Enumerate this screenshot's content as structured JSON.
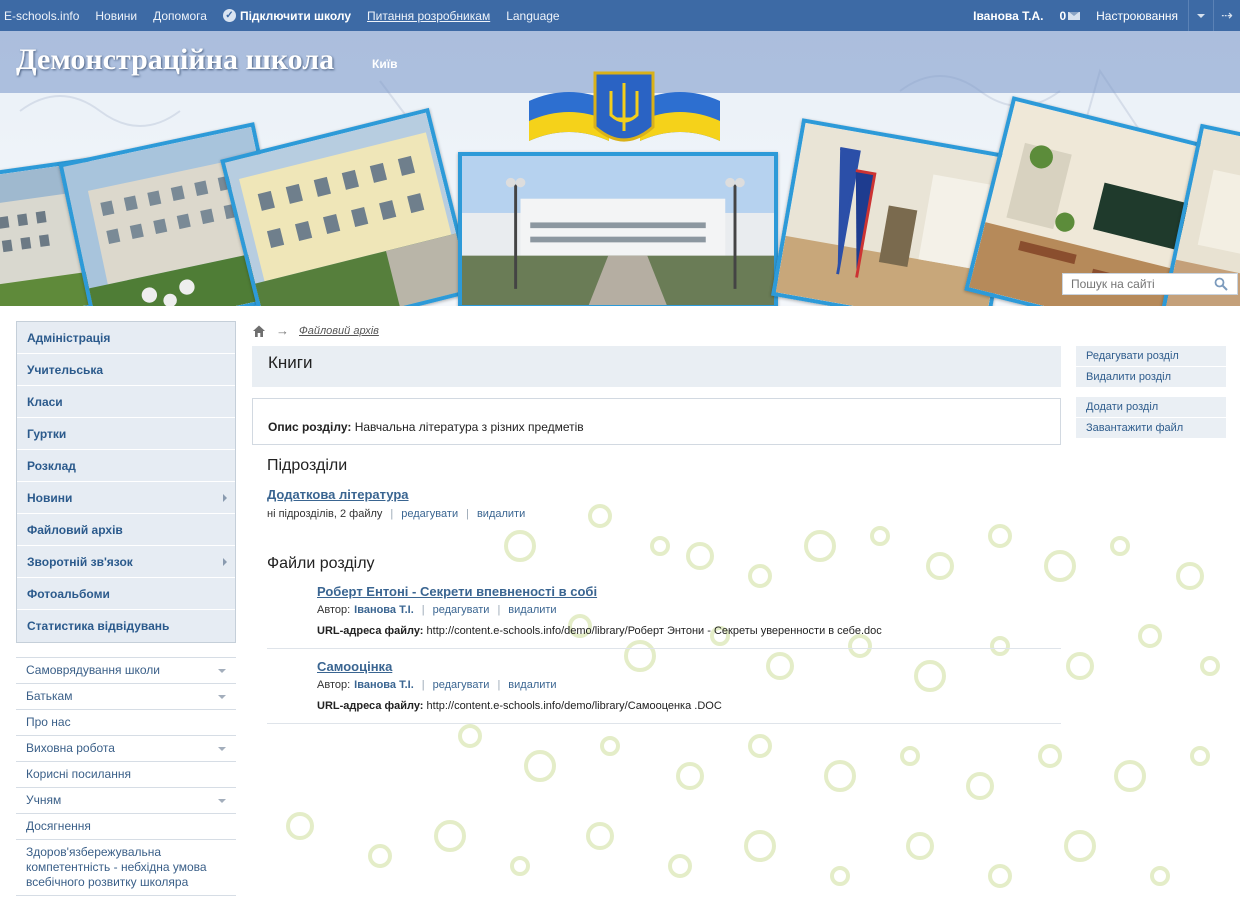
{
  "topbar": {
    "site": "E-schools.info",
    "news": "Новини",
    "help": "Допомога",
    "connect_school": "Підключити школу",
    "dev_questions": "Питання розробникам",
    "language": "Language",
    "user_name": "Іванова Т.А.",
    "messages_count": "0",
    "settings": "Настроювання"
  },
  "header": {
    "school_title": "Демонстраційна школа",
    "city": "Київ",
    "search_placeholder": "Пошук на сайті"
  },
  "left_menu": {
    "items": [
      {
        "label": "Адміністрація"
      },
      {
        "label": "Учительська"
      },
      {
        "label": "Класи"
      },
      {
        "label": "Гуртки"
      },
      {
        "label": "Розклад"
      },
      {
        "label": "Новини"
      },
      {
        "label": "Файловий архів"
      },
      {
        "label": "Зворотній зв'язок"
      },
      {
        "label": "Фотоальбоми"
      },
      {
        "label": "Статистика відвідувань"
      }
    ]
  },
  "left_menu2": {
    "items": [
      {
        "label": "Самоврядування школи"
      },
      {
        "label": "Батькам"
      },
      {
        "label": "Про нас"
      },
      {
        "label": "Виховна робота"
      },
      {
        "label": "Корисні посилання"
      },
      {
        "label": "Учням"
      },
      {
        "label": "Досягнення"
      },
      {
        "label": "Здоров'язбережувальна компетентність - небхідна умова всебічного розвитку школяра"
      }
    ]
  },
  "breadcrumb": {
    "current": "Файловий архів"
  },
  "main": {
    "page_title": "Книги",
    "desc_label": "Опис розділу:",
    "desc_value": "Навчальна література з різних предметів",
    "subsections_heading": "Підрозділи",
    "subsection": {
      "title": "Додаткова література",
      "meta": "ні підрозділів, 2 файлу",
      "edit": "редагувати",
      "delete": "видалити"
    },
    "files_heading": "Файли розділу",
    "files": [
      {
        "title": "Роберт Ентоні - Секрети впевненості в собі",
        "author_label": "Автор:",
        "author": "Іванова Т.І.",
        "edit": "редагувати",
        "delete": "видалити",
        "url_label": "URL-адреса файлу:",
        "url": "http://content.e-schools.info/demo/library/Роберт Энтони - Секреты уверенности в себе.doc"
      },
      {
        "title": "Самооцінка",
        "author_label": "Автор:",
        "author": "Іванова Т.І.",
        "edit": "редагувати",
        "delete": "видалити",
        "url_label": "URL-адреса файлу:",
        "url": "http://content.e-schools.info/demo/library/Самооценка .DOC"
      }
    ]
  },
  "right_panel": {
    "edit_section": "Редагувати розділ",
    "delete_section": "Видалити розділ",
    "add_section": "Додати розділ",
    "upload_file": "Завантажити файл"
  },
  "colors": {
    "topbar": "#3d6aa5",
    "link": "#3a6591",
    "photo_border": "#2d9ad8"
  }
}
